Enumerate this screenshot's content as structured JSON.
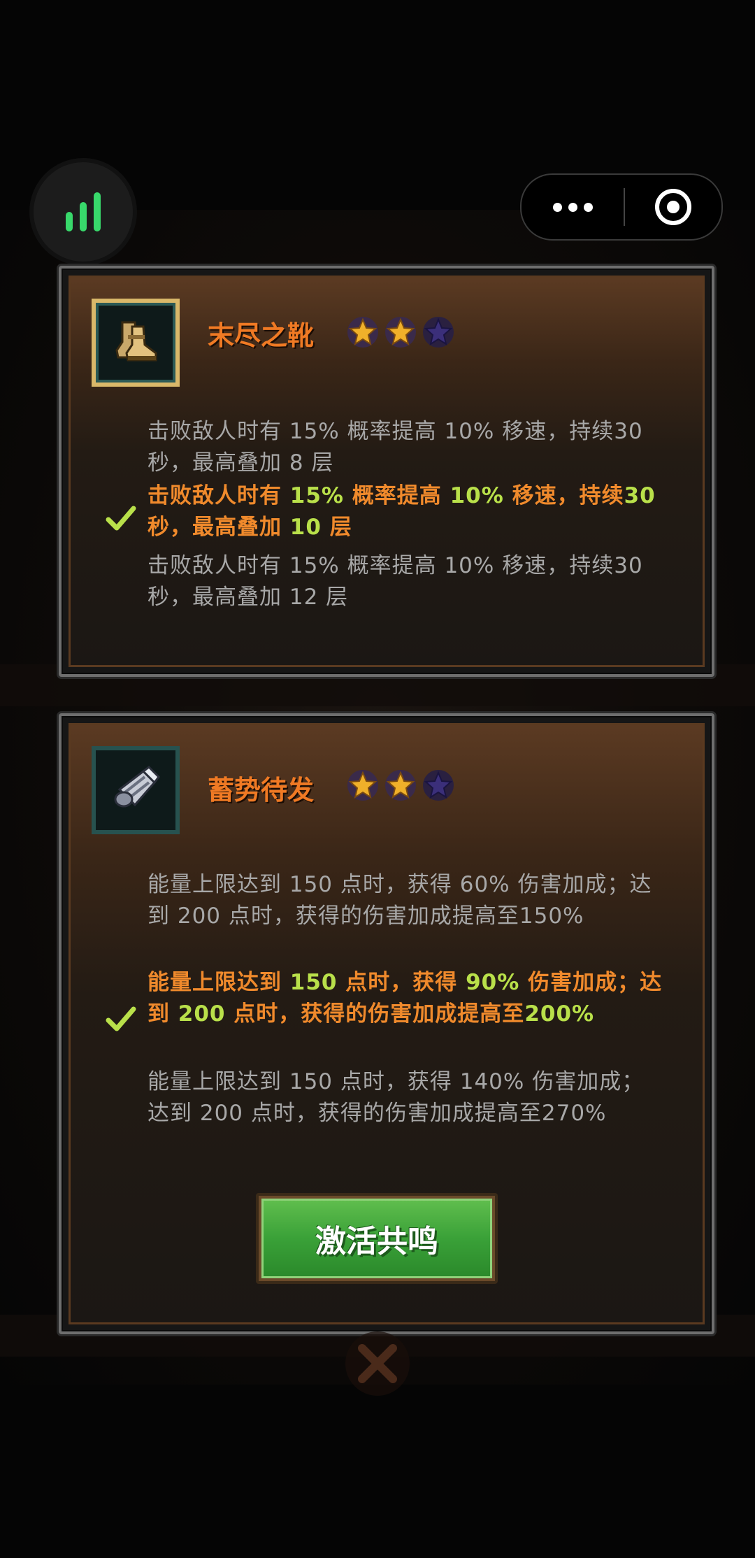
{
  "cards": [
    {
      "title": "末尽之靴",
      "icon": "boots-icon",
      "stars_filled": 2,
      "stars_total": 3,
      "levels": [
        {
          "text": "击败敌人时有 15% 概率提高 10% 移速，持续30 秒，最高叠加 8 层",
          "active": false
        },
        {
          "text": "击败敌人时有 15% 概率提高 10% 移速，持续30 秒，最高叠加 10 层",
          "active": true
        },
        {
          "text": "击败敌人时有 15% 概率提高 10% 移速，持续30 秒，最高叠加 12 层",
          "active": false
        }
      ]
    },
    {
      "title": "蓄势待发",
      "icon": "gauntlet-icon",
      "stars_filled": 2,
      "stars_total": 3,
      "levels": [
        {
          "text": "能量上限达到 150 点时，获得 60% 伤害加成；达到 200 点时，获得的伤害加成提高至150%",
          "active": false
        },
        {
          "text": "能量上限达到 150 点时，获得 90% 伤害加成；达到 200 点时，获得的伤害加成提高至200%",
          "active": true
        },
        {
          "text": "能量上限达到 150 点时，获得 140% 伤害加成；达到 200 点时，获得的伤害加成提高至270%",
          "active": false
        }
      ]
    }
  ],
  "activate_button": {
    "label": "激活共鸣"
  },
  "colors": {
    "title": "#f07a24",
    "active_text": "#f08a2c",
    "highlight": "#b9e04a",
    "inactive_text": "#a8a8a8",
    "button_green": "#3aa138",
    "signal_green": "#38d96b"
  }
}
